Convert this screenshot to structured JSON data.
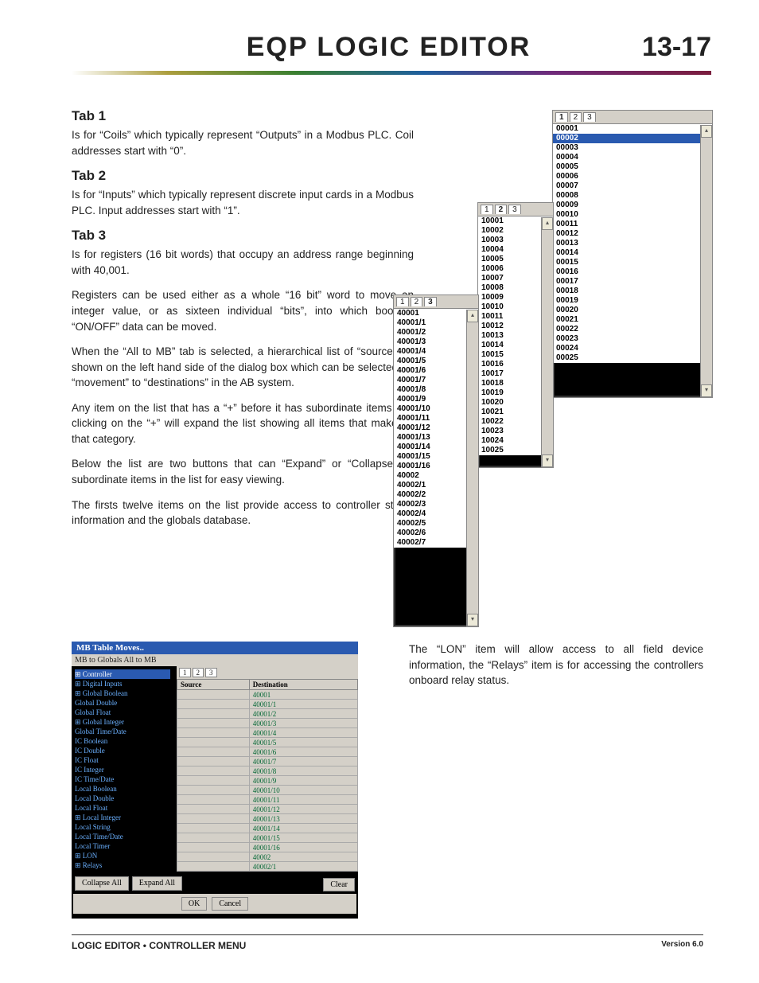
{
  "header": {
    "title": "EQP LOGIC EDITOR",
    "pageno": "13-17"
  },
  "sections": {
    "tab1": {
      "h": "Tab 1",
      "p": "Is for “Coils” which typically represent “Outputs” in a Modbus PLC.  Coil addresses start with “0”."
    },
    "tab2": {
      "h": "Tab 2",
      "p": "Is for “Inputs” which typically represent discrete input cards in a Modbus PLC.  Input addresses start with “1”."
    },
    "tab3": {
      "h": "Tab 3",
      "p1": "Is for registers (16 bit words) that occupy an address range beginning with 40,001.",
      "p2": "Registers can be used either as a whole “16 bit” word to move an integer value, or as sixteen individual “bits”, into which boolean “ON/OFF” data can be moved.",
      "p3": "When the “All to MB” tab is selected, a hierarchical list of “sources” is shown on the left hand side of the dialog box which can be selected for “movement” to “destinations” in the AB system.",
      "p4": "Any item on the list that has a “+” before it has subordinate items and clicking on the “+” will expand the list showing all items that make up that category.",
      "p5": "Below the list are two buttons that can “Expand” or “Collapse” all subordinate items in the list for easy viewing.",
      "p6": "The firsts twelve items on the list provide access to controller status information and the globals database."
    },
    "lon": "The “LON” item will allow access to all field device information, the “Relays” item is for accessing the controllers onboard relay status."
  },
  "fig1": {
    "tabs": [
      "1",
      "2",
      "3"
    ],
    "sel": 1,
    "items": [
      "00001",
      "00002",
      "00003",
      "00004",
      "00005",
      "00006",
      "00007",
      "00008",
      "00009",
      "00010",
      "00011",
      "00012",
      "00013",
      "00014",
      "00015",
      "00016",
      "00017",
      "00018",
      "00019",
      "00020",
      "00021",
      "00022",
      "00023",
      "00024",
      "00025"
    ]
  },
  "fig2": {
    "tabs": [
      "1",
      "2",
      "3"
    ],
    "items": [
      "10001",
      "10002",
      "10003",
      "10004",
      "10005",
      "10006",
      "10007",
      "10008",
      "10009",
      "10010",
      "10011",
      "10012",
      "10013",
      "10014",
      "10015",
      "10016",
      "10017",
      "10018",
      "10019",
      "10020",
      "10021",
      "10022",
      "10023",
      "10024",
      "10025"
    ]
  },
  "fig3": {
    "tabs": [
      "1",
      "2",
      "3"
    ],
    "items": [
      "40001",
      "40001/1",
      "40001/2",
      "40001/3",
      "40001/4",
      "40001/5",
      "40001/6",
      "40001/7",
      "40001/8",
      "40001/9",
      "40001/10",
      "40001/11",
      "40001/12",
      "40001/13",
      "40001/14",
      "40001/15",
      "40001/16",
      "40002",
      "40002/1",
      "40002/2",
      "40002/3",
      "40002/4",
      "40002/5",
      "40002/6",
      "40002/7"
    ]
  },
  "mb": {
    "title": "MB Table Moves..",
    "tabrow": "MB to Globals   All to MB",
    "tree": [
      "Controller",
      "Digital Inputs",
      "Global Boolean",
      "Global Double",
      "Global Float",
      "Global Integer",
      "Global Time/Date",
      "IC Boolean",
      "IC Double",
      "IC Float",
      "IC Integer",
      "IC Time/Date",
      "Local Boolean",
      "Local Double",
      "Local Float",
      "Local Integer",
      "Local String",
      "Local Time/Date",
      "Local Timer",
      "LON",
      "Relays"
    ],
    "tabs": [
      "1",
      "2",
      "3"
    ],
    "cols": {
      "src": "Source",
      "dst": "Destination"
    },
    "rows": [
      "40001",
      "40001/1",
      "40001/2",
      "40001/3",
      "40001/4",
      "40001/5",
      "40001/6",
      "40001/7",
      "40001/8",
      "40001/9",
      "40001/10",
      "40001/11",
      "40001/12",
      "40001/13",
      "40001/14",
      "40001/15",
      "40001/16",
      "40002",
      "40002/1"
    ],
    "buttons": {
      "collapse": "Collapse All",
      "expand": "Expand All",
      "clear": "Clear",
      "ok": "OK",
      "cancel": "Cancel"
    }
  },
  "footer": {
    "left": "LOGIC EDITOR • CONTROLLER MENU",
    "right": "Version 6.0"
  }
}
